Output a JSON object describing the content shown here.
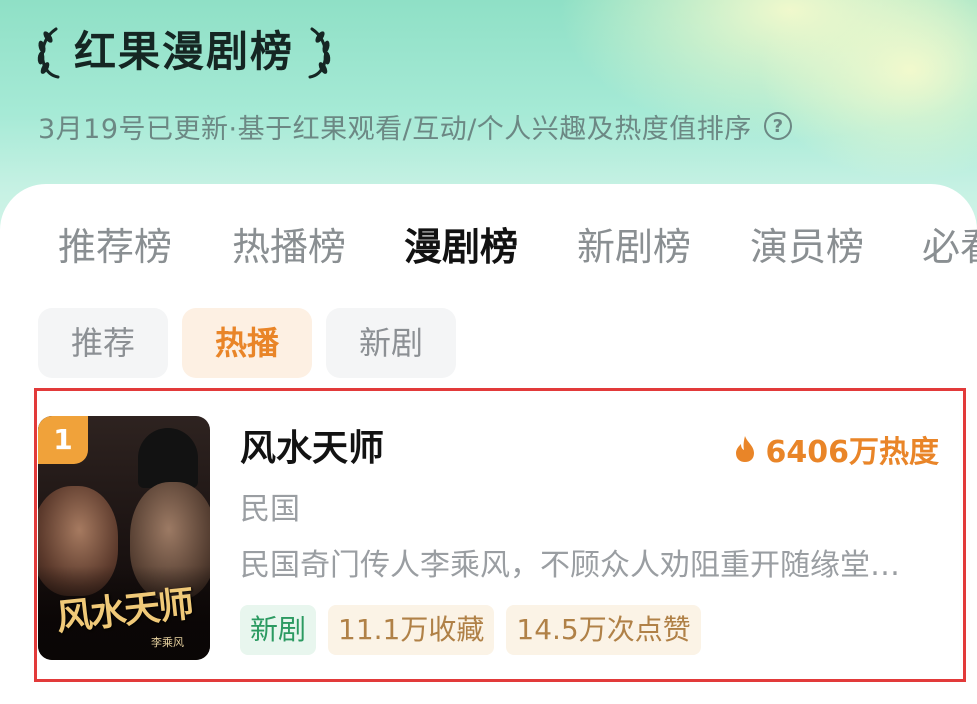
{
  "header": {
    "title": "红果漫剧榜",
    "subtitle": "3月19号已更新·基于红果观看/互动/个人兴趣及热度值排序",
    "help_icon": "?"
  },
  "tabs": [
    {
      "label": "推荐榜",
      "active": false
    },
    {
      "label": "热播榜",
      "active": false
    },
    {
      "label": "漫剧榜",
      "active": true
    },
    {
      "label": "新剧榜",
      "active": false
    },
    {
      "label": "演员榜",
      "active": false
    },
    {
      "label": "必看",
      "active": false
    }
  ],
  "filters": [
    {
      "label": "推荐",
      "active": false
    },
    {
      "label": "热播",
      "active": true
    },
    {
      "label": "新剧",
      "active": false
    }
  ],
  "list": [
    {
      "rank": "1",
      "title": "风水天师",
      "heat": "6406万热度",
      "genre": "民国",
      "description": "民国奇门传人李乘风，不顾众人劝阻重开随缘堂…",
      "poster_title": "风水天师",
      "poster_subtitle": "李乘风",
      "tags": [
        {
          "label": "新剧",
          "style": "green"
        },
        {
          "label": "11.1万收藏",
          "style": "tan"
        },
        {
          "label": "14.5万次点赞",
          "style": "tan"
        }
      ]
    }
  ],
  "colors": {
    "accent_orange": "#e98528",
    "highlight_border": "#e23a3a",
    "hero_mint": "#a6ead6",
    "tag_green": "#2b9a61"
  },
  "icons": {
    "laurel_left": "laurel-left-icon",
    "laurel_right": "laurel-right-icon",
    "help": "question-circle-icon",
    "heat": "flame-icon"
  }
}
